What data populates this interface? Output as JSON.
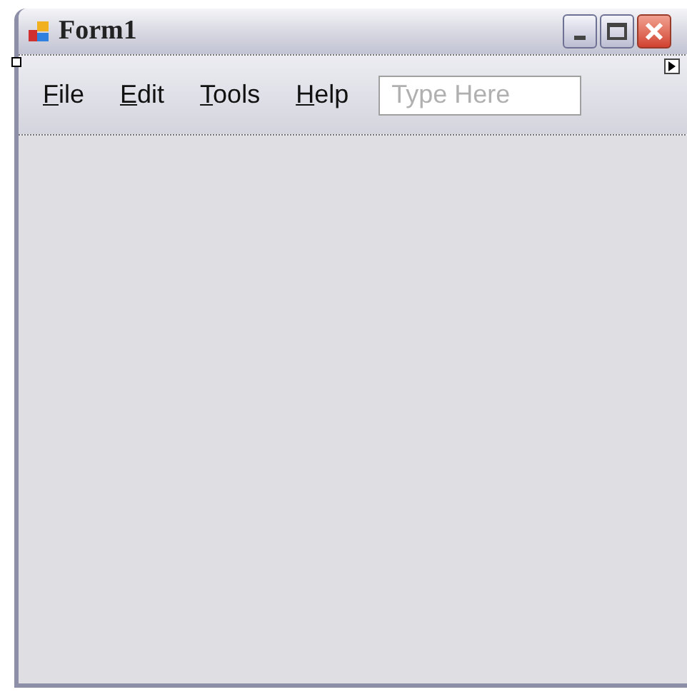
{
  "window": {
    "title": "Form1"
  },
  "menu": {
    "items": [
      {
        "label": "File"
      },
      {
        "label": "Edit"
      },
      {
        "label": "Tools"
      },
      {
        "label": "Help"
      }
    ],
    "new_item": {
      "placeholder": "Type Here"
    }
  }
}
